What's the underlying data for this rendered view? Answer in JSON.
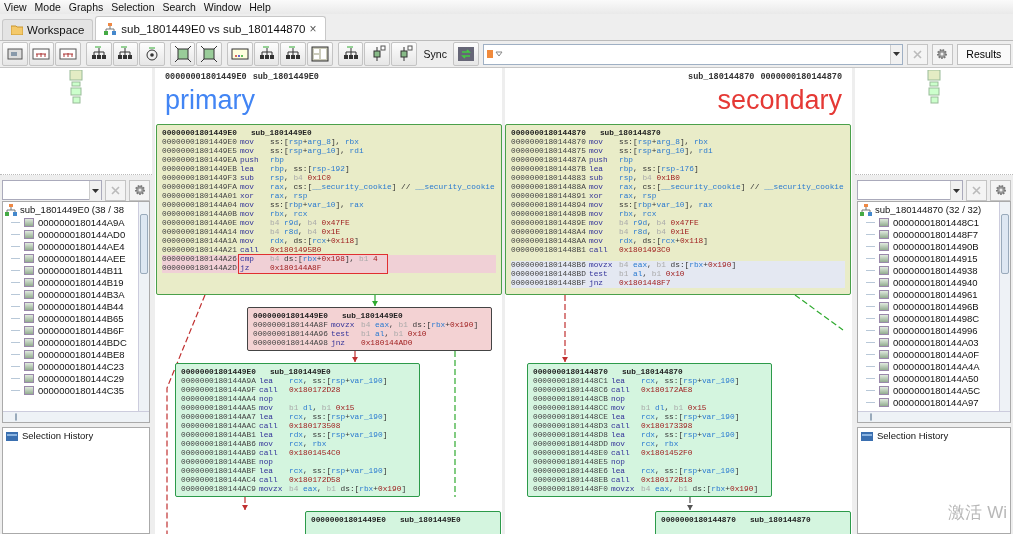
{
  "menu": [
    "View",
    "Mode",
    "Graphs",
    "Selection",
    "Search",
    "Window",
    "Help"
  ],
  "tabs": [
    {
      "label": "Workspace",
      "selected": false
    },
    {
      "label": "sub_1801449E0 vs sub_180144870",
      "selected": true,
      "close": "×"
    }
  ],
  "toolbar": {
    "sync_label": "Sync",
    "results_button": "Results"
  },
  "side_panels": [
    {
      "tree": {
        "label": "sub_1801449E0 (38 / 38",
        "children": [
          {
            "label": "0000000180144A9A"
          },
          {
            "label": "0000000180144AD0"
          },
          {
            "label": "0000000180144AE4"
          },
          {
            "label": "0000000180144AEE"
          },
          {
            "label": "0000000180144B11"
          },
          {
            "label": "0000000180144B19"
          },
          {
            "label": "0000000180144B3A"
          },
          {
            "label": "0000000180144B44"
          },
          {
            "label": "0000000180144B65"
          },
          {
            "label": "0000000180144B6F"
          },
          {
            "label": "0000000180144BDC"
          },
          {
            "label": "0000000180144BE8"
          },
          {
            "label": "0000000180144C23"
          },
          {
            "label": "0000000180144C29"
          },
          {
            "label": "0000000180144C35"
          }
        ]
      },
      "history_label": "Selection History"
    },
    {
      "tree": {
        "label": "sub_180144870 (32 / 32)",
        "children": [
          {
            "label": "00000001801448C1"
          },
          {
            "label": "00000001801448F7"
          },
          {
            "label": "000000018014490B"
          },
          {
            "label": "0000000180144915"
          },
          {
            "label": "0000000180144938"
          },
          {
            "label": "0000000180144940"
          },
          {
            "label": "0000000180144961"
          },
          {
            "label": "000000018014496B"
          },
          {
            "label": "000000018014498C"
          },
          {
            "label": "0000000180144996"
          },
          {
            "label": "0000000180144A03"
          },
          {
            "label": "0000000180144A0F"
          },
          {
            "label": "0000000180144A4A"
          },
          {
            "label": "0000000180144A50"
          },
          {
            "label": "0000000180144A5C"
          },
          {
            "label": "0000000180144A97"
          }
        ]
      },
      "history_label": "Selection History"
    }
  ],
  "graphs": [
    {
      "kind": "primary",
      "header_address": "00000001801449E0",
      "header_name": "sub_1801449E0",
      "title": "primary",
      "nodes": [
        {
          "kind": "changed",
          "address": "00000001801449E0",
          "name": "sub_1801449E0",
          "blocks": [
            {
              "kind": "plain",
              "rows": [
                {
                  "addr": "00000001801449E0",
                  "op": "mov",
                  "args": "ss:[rsp+arg_8], rbx"
                },
                {
                  "addr": "00000001801449E5",
                  "op": "mov",
                  "args": "ss:[rsp+arg_10], rdi"
                },
                {
                  "addr": "00000001801449EA",
                  "op": "push",
                  "args": "rbp"
                },
                {
                  "addr": "00000001801449EB",
                  "op": "lea",
                  "args": "rbp, ss:[rsp-192]"
                },
                {
                  "addr": "00000001801449F3",
                  "op": "sub",
                  "args": "rsp, b4 0x1C0"
                },
                {
                  "addr": "00000001801449FA",
                  "op": "mov",
                  "args": "rax, cs:[__security_cookie] // __security_cookie"
                },
                {
                  "addr": "0000000180144A01",
                  "op": "xor",
                  "args": "rax, rsp"
                },
                {
                  "addr": "0000000180144A04",
                  "op": "mov",
                  "args": "ss:[rbp+var_10], rax"
                },
                {
                  "addr": "0000000180144A0B",
                  "op": "mov",
                  "args": "rbx, rcx"
                },
                {
                  "addr": "0000000180144A0E",
                  "op": "mov",
                  "args": "b4 r9d, b4 0x47FE"
                },
                {
                  "addr": "0000000180144A14",
                  "op": "mov",
                  "args": "b4 r8d, b4 0x1E"
                },
                {
                  "addr": "0000000180144A1A",
                  "op": "mov",
                  "args": "rdx, ds:[rcx+0x118]"
                },
                {
                  "addr": "0000000180144A21",
                  "op": "call",
                  "args": "0x1801495B0"
                }
              ]
            },
            {
              "kind": "changed",
              "rows": [
                {
                  "addr": "0000000180144A26",
                  "op": "cmp",
                  "args": "b4 ds:[rbx+0x198], b1 4"
                },
                {
                  "addr": "0000000180144A2D",
                  "op": "jz",
                  "args": "0x180144A8F"
                }
              ]
            }
          ]
        },
        {
          "kind": "unmatched",
          "address": "00000001801449E0",
          "name": "sub_1801449E0",
          "blocks": [
            {
              "kind": "plain",
              "rows": [
                {
                  "addr": "0000000180144A8F",
                  "op": "movzx",
                  "args": "b4 eax, b1 ds:[rbx+0x190]"
                },
                {
                  "addr": "0000000180144A96",
                  "op": "test",
                  "args": "b1 al, b1 0x10"
                },
                {
                  "addr": "0000000180144A98",
                  "op": "jnz",
                  "args": "0x180144AD0"
                }
              ]
            }
          ]
        },
        {
          "kind": "matched",
          "address": "00000001801449E0",
          "name": "sub_1801449E0",
          "blocks": [
            {
              "kind": "plain",
              "rows": [
                {
                  "addr": "0000000180144A9A",
                  "op": "lea",
                  "args": "rcx, ss:[rsp+var_190]"
                },
                {
                  "addr": "0000000180144A9F",
                  "op": "call",
                  "args": "0x180172D28"
                },
                {
                  "addr": "0000000180144AA4",
                  "op": "nop"
                },
                {
                  "addr": "0000000180144AA5",
                  "op": "mov",
                  "args": "b1 dl, b1 0x15"
                },
                {
                  "addr": "0000000180144AA7",
                  "op": "lea",
                  "args": "rcx, ss:[rsp+var_190]"
                },
                {
                  "addr": "0000000180144AAC",
                  "op": "call",
                  "args": "0x180173508"
                },
                {
                  "addr": "0000000180144AB1",
                  "op": "lea",
                  "args": "rdx, ss:[rsp+var_190]"
                },
                {
                  "addr": "0000000180144AB6",
                  "op": "mov",
                  "args": "rcx, rbx"
                },
                {
                  "addr": "0000000180144AB9",
                  "op": "call",
                  "args": "0x1801454C0"
                },
                {
                  "addr": "0000000180144ABE",
                  "op": "nop"
                },
                {
                  "addr": "0000000180144ABF",
                  "op": "lea",
                  "args": "rcx, ss:[rsp+var_190]"
                },
                {
                  "addr": "0000000180144AC4",
                  "op": "call",
                  "args": "0x180172D58"
                },
                {
                  "addr": "0000000180144AC9",
                  "op": "movzx",
                  "args": "b4 eax, b1 ds:[rbx+0x190]"
                }
              ]
            }
          ]
        },
        {
          "kind": "matched",
          "address": "00000001801449E0",
          "name": "sub_1801449E0"
        }
      ]
    },
    {
      "kind": "secondary",
      "header_address": "0000000180144870",
      "header_name": "sub_180144870",
      "title": "secondary",
      "nodes": [
        {
          "kind": "changed",
          "address": "0000000180144870",
          "name": "sub_180144870",
          "blocks": [
            {
              "kind": "plain",
              "rows": [
                {
                  "addr": "0000000180144870",
                  "op": "mov",
                  "args": "ss:[rsp+arg_8], rbx"
                },
                {
                  "addr": "0000000180144875",
                  "op": "mov",
                  "args": "ss:[rsp+arg_10], rdi"
                },
                {
                  "addr": "000000018014487A",
                  "op": "push",
                  "args": "rbp"
                },
                {
                  "addr": "000000018014487B",
                  "op": "lea",
                  "args": "rbp, ss:[rsp-176]"
                },
                {
                  "addr": "0000000180144883",
                  "op": "sub",
                  "args": "rsp, b4 0x1B0"
                },
                {
                  "addr": "000000018014488A",
                  "op": "mov",
                  "args": "rax, cs:[__security_cookie] // __security_cookie"
                },
                {
                  "addr": "0000000180144891",
                  "op": "xor",
                  "args": "rax, rsp"
                },
                {
                  "addr": "0000000180144894",
                  "op": "mov",
                  "args": "ss:[rbp+var_10], rax"
                },
                {
                  "addr": "000000018014489B",
                  "op": "mov",
                  "args": "rbx, rcx"
                },
                {
                  "addr": "000000018014489E",
                  "op": "mov",
                  "args": "b4 r9d, b4 0x47FE"
                },
                {
                  "addr": "00000001801448A4",
                  "op": "mov",
                  "args": "b4 r8d, b4 0x1E"
                },
                {
                  "addr": "00000001801448AA",
                  "op": "mov",
                  "args": "rdx, ds:[rcx+0x118]"
                },
                {
                  "addr": "00000001801448B1",
                  "op": "call",
                  "args": "0x1801493C0"
                }
              ]
            },
            {
              "kind": "merged",
              "rows": [
                {
                  "addr": "00000001801448B6",
                  "op": "movzx",
                  "args": "b4 eax, b1 ds:[rbx+0x190]"
                },
                {
                  "addr": "00000001801448BD",
                  "op": "test",
                  "args": "b1 al, b1 0x10"
                },
                {
                  "addr": "00000001801448BF",
                  "op": "jnz",
                  "args": "0x1801448F7"
                }
              ]
            }
          ]
        },
        {
          "kind": "matched",
          "address": "0000000180144870",
          "name": "sub_180144870",
          "blocks": [
            {
              "kind": "plain",
              "rows": [
                {
                  "addr": "00000001801448C1",
                  "op": "lea",
                  "args": "rcx, ss:[rsp+var_190]"
                },
                {
                  "addr": "00000001801448C6",
                  "op": "call",
                  "args": "0x180172AE8"
                },
                {
                  "addr": "00000001801448CB",
                  "op": "nop"
                },
                {
                  "addr": "00000001801448CC",
                  "op": "mov",
                  "args": "b1 dl, b1 0x15"
                },
                {
                  "addr": "00000001801448CE",
                  "op": "lea",
                  "args": "rcx, ss:[rsp+var_190]"
                },
                {
                  "addr": "00000001801448D3",
                  "op": "call",
                  "args": "0x180173398"
                },
                {
                  "addr": "00000001801448D8",
                  "op": "lea",
                  "args": "rdx, ss:[rsp+var_190]"
                },
                {
                  "addr": "00000001801448DD",
                  "op": "mov",
                  "args": "rcx, rbx"
                },
                {
                  "addr": "00000001801448E0",
                  "op": "call",
                  "args": "0x1801452F0"
                },
                {
                  "addr": "00000001801448E5",
                  "op": "nop"
                },
                {
                  "addr": "00000001801448E6",
                  "op": "lea",
                  "args": "rcx, ss:[rsp+var_190]"
                },
                {
                  "addr": "00000001801448EB",
                  "op": "call",
                  "args": "0x180172B18"
                },
                {
                  "addr": "00000001801448F0",
                  "op": "movzx",
                  "args": "b4 eax, b1 ds:[rbx+0x190]"
                }
              ]
            }
          ]
        },
        {
          "kind": "matched",
          "address": "0000000180144870",
          "name": "sub_180144870"
        }
      ]
    }
  ],
  "overlay_text": "激活 Wi"
}
